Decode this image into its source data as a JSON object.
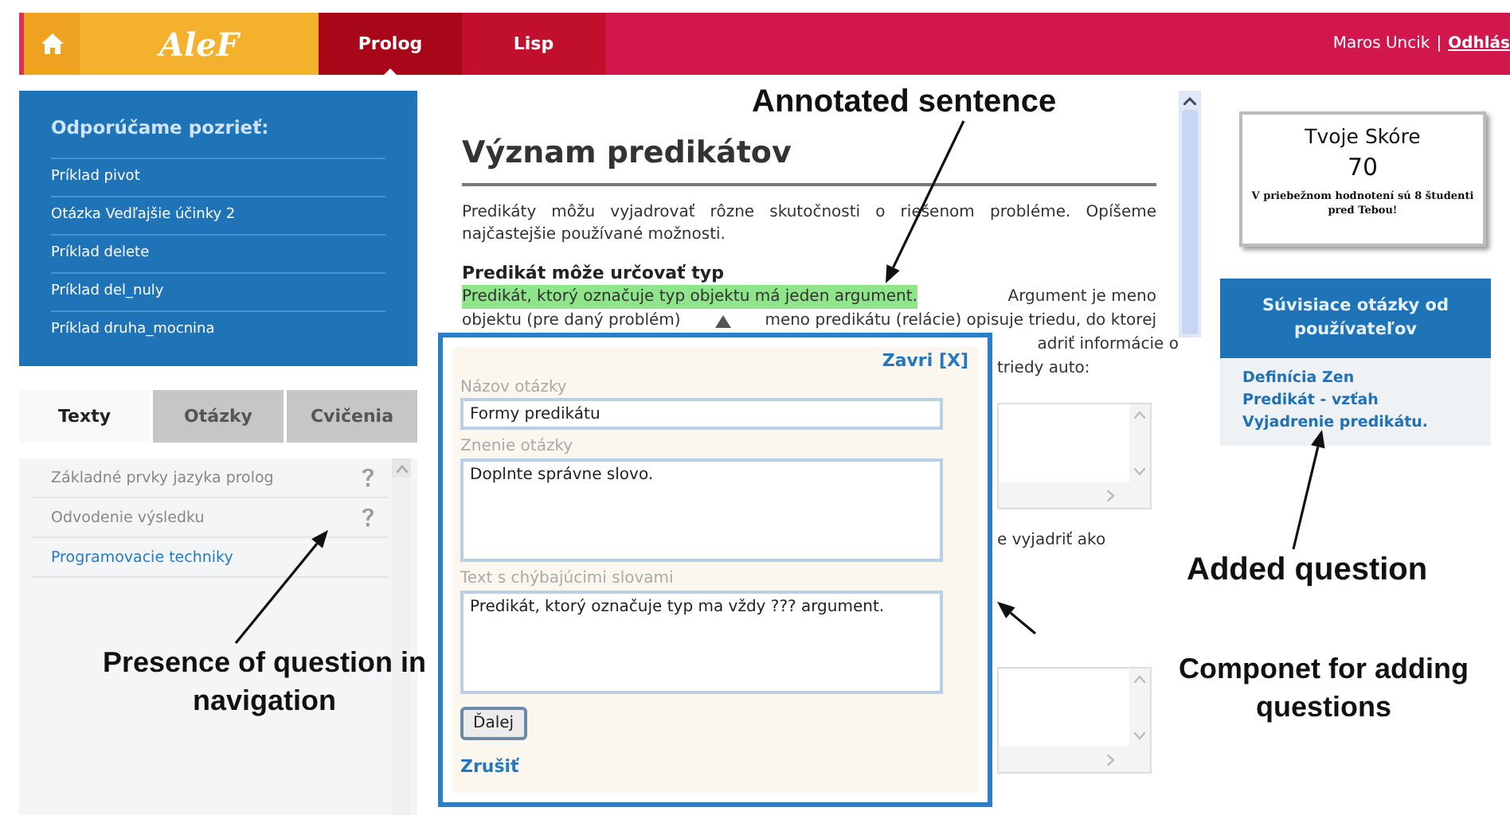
{
  "top_bar": {
    "logo": "AleF",
    "tabs": [
      {
        "label": "Prolog",
        "selected": true
      },
      {
        "label": "Lisp",
        "selected": false
      }
    ],
    "user": "Maros Uncik",
    "separator": "|",
    "logout": "Odhlás"
  },
  "recommended": {
    "title": "Odporúčame pozrieť:",
    "items": [
      "Príklad pivot",
      "Otázka Vedľajšie účinky 2",
      "Príklad delete",
      "Príklad del_nuly",
      "Príklad druha_mocnina"
    ]
  },
  "left_tabs": [
    {
      "label": "Texty",
      "selected": true
    },
    {
      "label": "Otázky",
      "selected": false
    },
    {
      "label": "Cvičenia",
      "selected": false
    }
  ],
  "navigation": [
    {
      "label": "Základné prvky jazyka prolog",
      "has_question": true,
      "selected": false
    },
    {
      "label": "Odvodenie výsledku",
      "has_question": true,
      "selected": false
    },
    {
      "label": "Programovacie techniky",
      "has_question": false,
      "selected": true
    }
  ],
  "content": {
    "heading": "Význam predikátov",
    "intro": "Predikáty môžu vyjadrovať rôzne skutočnosti o riešenom probléme. Opíšeme najčastejšie používané možnosti.",
    "subheading": "Predikát môže určovať typ",
    "highlighted_sentence": "Predikát, ktorý označuje typ objektu má jeden argument.",
    "line_1_rest": "Argument je meno",
    "line_2_start": "objektu (pre daný problém)",
    "line_2_end": "meno predikátu (relácie) opisuje triedu, do ktorej",
    "fragment_1": "adriť informácie o",
    "fragment_2": "triedy auto:",
    "fragment_3": "e vyjadriť ako"
  },
  "question_form": {
    "close": "Zavri [X]",
    "fields": [
      {
        "label": "Názov otázky",
        "value": "Formy predikátu",
        "kind": "input"
      },
      {
        "label": "Znenie otázky",
        "value": "Doplnte správne slovo.",
        "kind": "textarea"
      },
      {
        "label": "Text s chýbajúcimi slovami",
        "value": "Predikát, ktorý označuje typ ma vždy ??? argument.",
        "kind": "textarea"
      }
    ],
    "next_button": "Ďalej",
    "cancel": "Zrušiť"
  },
  "score": {
    "title": "Tvoje Skóre",
    "value": "70",
    "note": "V priebežnom hodnotení sú 8 študenti pred Tebou!"
  },
  "related": {
    "title": "Súvisiace otázky od používateľov",
    "items": [
      "Definícia Zen",
      "Predikát - vzťah",
      "Vyjadrenie predikátu."
    ]
  },
  "annotations": [
    {
      "text": "Annotated sentence"
    },
    {
      "text": "Added question"
    },
    {
      "text": "Presence of question in navigation"
    },
    {
      "text": "Componet for adding questions"
    }
  ]
}
